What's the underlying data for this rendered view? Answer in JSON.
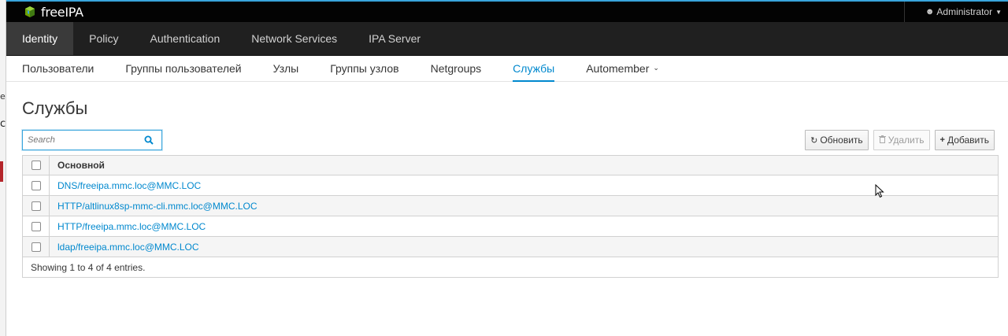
{
  "masthead": {
    "brand": "freeIPA",
    "user": "Administrator"
  },
  "primary_nav": [
    {
      "label": "Identity",
      "active": true
    },
    {
      "label": "Policy"
    },
    {
      "label": "Authentication"
    },
    {
      "label": "Network Services"
    },
    {
      "label": "IPA Server"
    }
  ],
  "secondary_nav": [
    {
      "label": "Пользователи"
    },
    {
      "label": "Группы пользователей"
    },
    {
      "label": "Узлы"
    },
    {
      "label": "Группы узлов"
    },
    {
      "label": "Netgroups"
    },
    {
      "label": "Службы",
      "active": true
    },
    {
      "label": "Automember"
    }
  ],
  "page": {
    "title": "Службы"
  },
  "search": {
    "placeholder": "Search",
    "value": ""
  },
  "toolbar": {
    "refresh_label": "Обновить",
    "delete_label": "Удалить",
    "add_label": "Добавить"
  },
  "table": {
    "column_header": "Основной",
    "rows": [
      "DNS/freeipa.mmc.loc@MMC.LOC",
      "HTTP/altlinux8sp-mmc-cli.mmc.loc@MMC.LOC",
      "HTTP/freeipa.mmc.loc@MMC.LOC",
      "ldap/freeipa.mmc.loc@MMC.LOC"
    ],
    "footer": "Showing 1 to 4 of 4 entries."
  },
  "colors": {
    "accent": "#0088ce",
    "masthead_bg": "#030303",
    "nav_bg": "#202020"
  }
}
